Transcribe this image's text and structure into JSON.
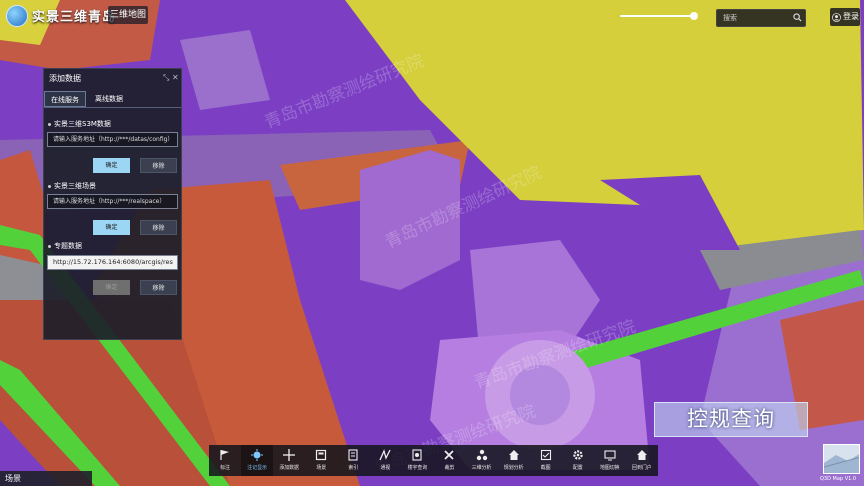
{
  "header": {
    "app_title": "实景三维青岛",
    "mode_tab": "三维地图",
    "search_placeholder": "搜索",
    "login_label": "登录",
    "slider_value": 1.0
  },
  "panel": {
    "title": "添加数据",
    "tabs": [
      "在线服务",
      "离线数据"
    ],
    "active_tab": 0,
    "sections": [
      {
        "label": "实景三维S3M数据",
        "field_value": "请输入服务地址（http://***/datas/config）",
        "ok_label": "确定",
        "remove_label": "移除"
      },
      {
        "label": "实景三维场景",
        "field_value": "请输入服务地址（http://***/realspace）",
        "ok_label": "确定",
        "remove_label": "移除"
      },
      {
        "label": "专题数据",
        "field_value": "http://15.72.176.164:6080/arcgis/res",
        "ok_label": "确定",
        "remove_label": "移除"
      }
    ]
  },
  "scene_panel_label": "场景",
  "toolbar": [
    {
      "label": "标注",
      "icon": "flag-icon"
    },
    {
      "label": "注记显示",
      "icon": "light-icon"
    },
    {
      "label": "添加数据",
      "icon": "plus-icon"
    },
    {
      "label": "场景",
      "icon": "scene-icon"
    },
    {
      "label": "索引",
      "icon": "index-icon"
    },
    {
      "label": "通视",
      "icon": "sight-icon"
    },
    {
      "label": "楼宇查询",
      "icon": "building-query-icon"
    },
    {
      "label": "裁剪",
      "icon": "clip-icon"
    },
    {
      "label": "三维分析",
      "icon": "analysis-icon"
    },
    {
      "label": "规划分析",
      "icon": "home-icon"
    },
    {
      "label": "截图",
      "icon": "screenshot-icon"
    },
    {
      "label": "配置",
      "icon": "gear-icon"
    },
    {
      "label": "地图切换",
      "icon": "map-switch-icon"
    },
    {
      "label": "回到门户",
      "icon": "portal-icon"
    }
  ],
  "active_tool": 1,
  "caption": "控规查询",
  "minimap_label": "Q3D Map V1.0",
  "watermark": "青岛市勘察测绘研究院",
  "colors": {
    "residential": "#c85a3c",
    "commercial": "#8a3fd0",
    "yellow_zone": "#d4cf3a",
    "green": "#4fd13a",
    "road": "#8d8f95",
    "toolbar_active": "#7fc8ff"
  }
}
